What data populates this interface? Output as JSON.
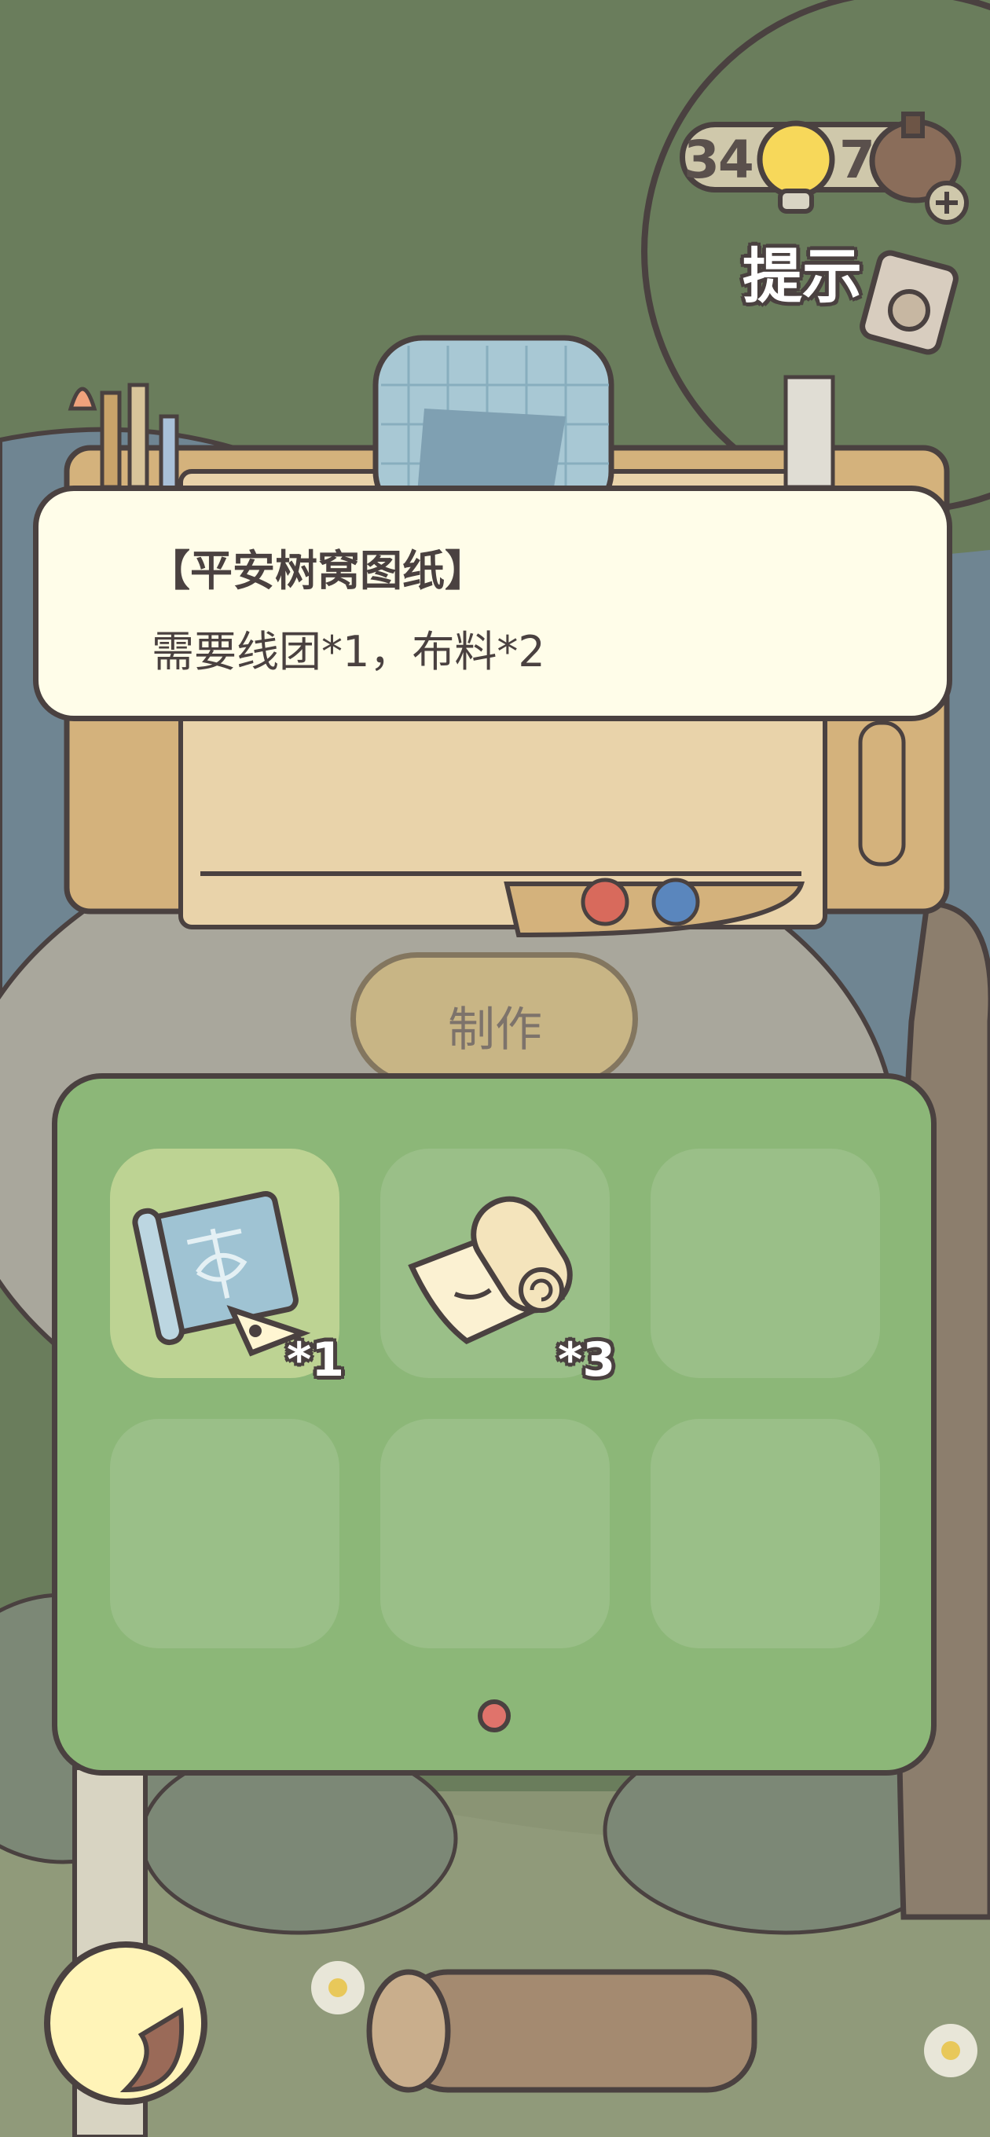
{
  "hud": {
    "bulb_count": "34",
    "bulb_count_tail": "7",
    "hint_label": "提示"
  },
  "recipe": {
    "title": "【平安树窝图纸】",
    "requirement": "需要线团*1，布料*2"
  },
  "craft_button": {
    "label": "制作"
  },
  "inventory": {
    "slots": [
      {
        "item": "blueprint-icon",
        "count": "*1",
        "selected": true
      },
      {
        "item": "fabric-roll-icon",
        "count": "*3",
        "selected": false
      },
      {
        "item": "",
        "count": "",
        "selected": false
      },
      {
        "item": "",
        "count": "",
        "selected": false
      },
      {
        "item": "",
        "count": "",
        "selected": false
      },
      {
        "item": "",
        "count": "",
        "selected": false
      }
    ],
    "page_indicator_color": "#e0736b"
  },
  "colors": {
    "outline": "#4a4140",
    "panel_green": "#8cb778",
    "card_cream": "#fffde9"
  }
}
